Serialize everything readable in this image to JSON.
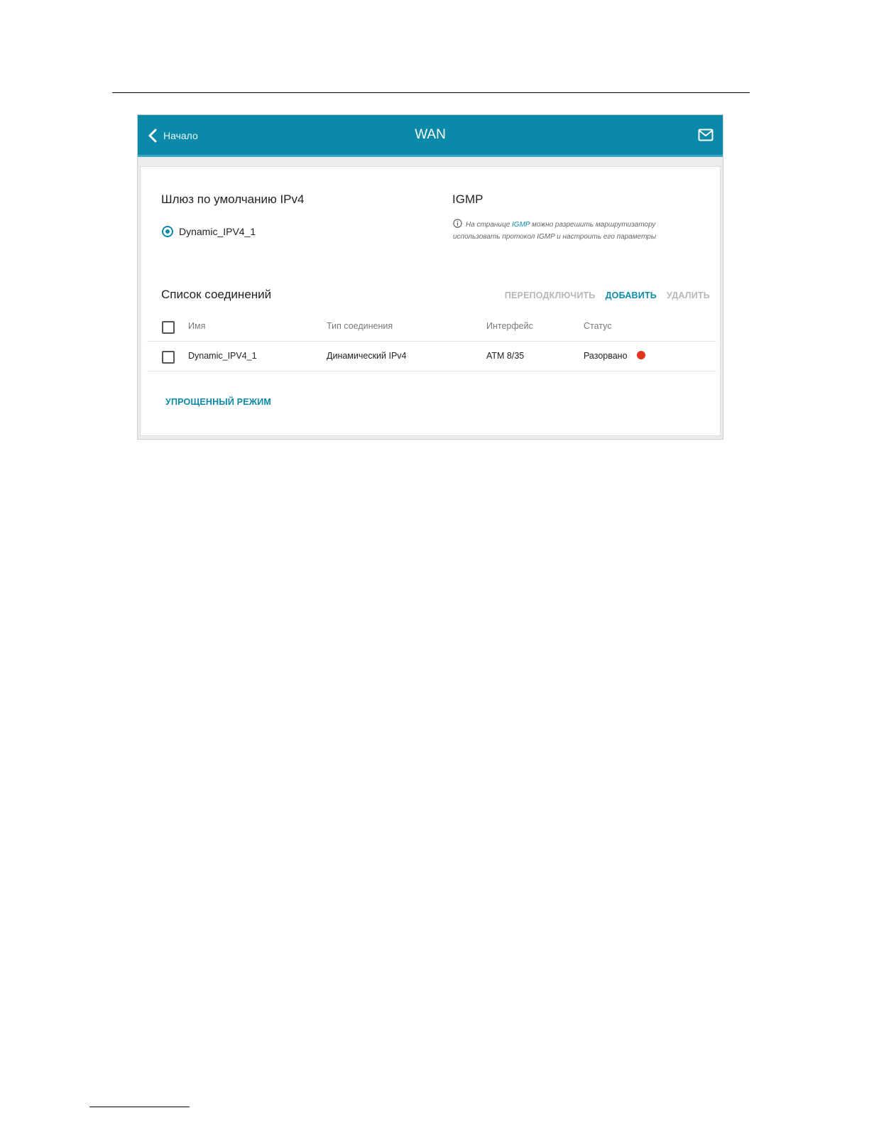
{
  "header": {
    "back_label": "Начало",
    "title": "WAN",
    "back_icon": "chevron-left-icon",
    "mail_icon": "mail-icon"
  },
  "gateway": {
    "title": "Шлюз по умолчанию IPv4",
    "selected": "Dynamic_IPV4_1"
  },
  "igmp": {
    "title": "IGMP",
    "info_prefix": "На странице ",
    "info_link": "IGMP",
    "info_suffix_line1": " можно разрешить маршрутизатору",
    "info_line2": "использовать протокол IGMP и настроить его параметры",
    "info_icon": "info-icon"
  },
  "connections": {
    "title": "Список соединений",
    "actions": {
      "reconnect": "ПЕРЕПОДКЛЮЧИТЬ",
      "add": "ДОБАВИТЬ",
      "delete": "УДАЛИТЬ"
    },
    "columns": [
      "Имя",
      "Тип соединения",
      "Интерфейс",
      "Статус"
    ],
    "rows": [
      {
        "name": "Dynamic_IPV4_1",
        "type": "Динамический IPv4",
        "interface": "ATM 8/35",
        "status": "Разорвано",
        "status_color": "#e2351f"
      }
    ]
  },
  "footer": {
    "simple_mode": "УПРОЩЕННЫЙ РЕЖИМ"
  },
  "colors": {
    "accent": "#0b89a8",
    "status_disconnected": "#e2351f"
  }
}
